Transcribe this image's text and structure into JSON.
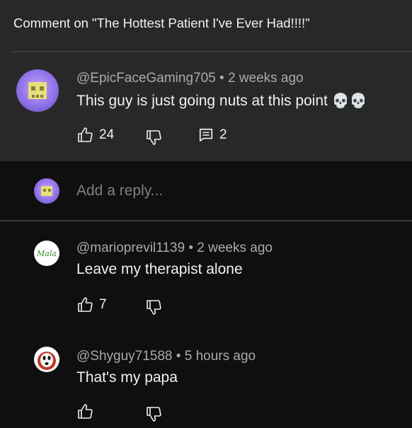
{
  "header": {
    "title": "Comment on \"The Hottest Patient I've Ever Had!!!!\""
  },
  "main_comment": {
    "author": "@EpicFaceGaming705",
    "separator": "•",
    "time": "2 weeks ago",
    "text": "This guy is just going nuts at this point",
    "emoji": "💀💀",
    "likes": "24",
    "replies": "2"
  },
  "reply_box": {
    "placeholder": "Add a reply..."
  },
  "replies": [
    {
      "author": "@marioprevil1139",
      "separator": "•",
      "time": "2 weeks ago",
      "text": "Leave my therapist alone",
      "likes": "7",
      "avatar_text": "Mala"
    },
    {
      "author": "@Shyguy71588",
      "separator": "•",
      "time": "5 hours ago",
      "text": "That's my papa",
      "likes": ""
    }
  ],
  "colors": {
    "top_bg": "#282828",
    "page_bg": "#0f0f0f",
    "muted": "#aaaaaa",
    "avatar_green": "#3c8b2a"
  }
}
